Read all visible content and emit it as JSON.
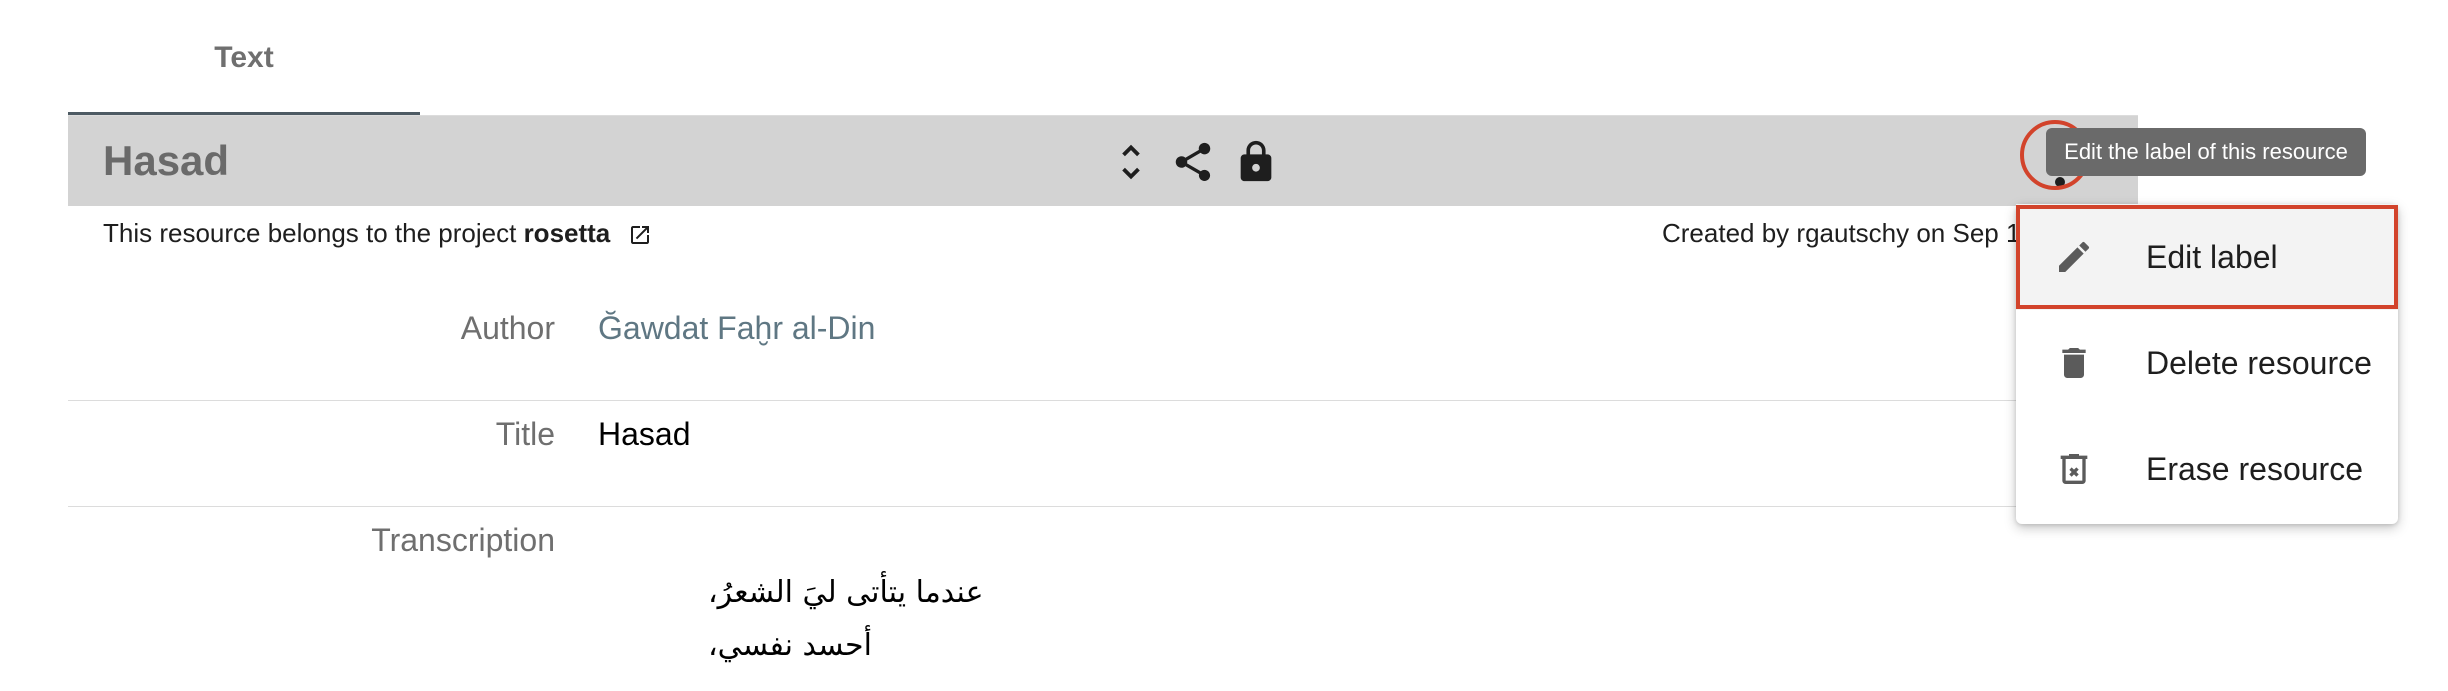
{
  "tabs": [
    {
      "label": "Text"
    }
  ],
  "header": {
    "title": "Hasad",
    "icons": [
      "expand-collapse-icon",
      "share-icon",
      "lock-icon",
      "more-vert-icon"
    ]
  },
  "info": {
    "project_prefix": "This resource belongs to the project ",
    "project_name": "rosetta",
    "created": "Created by rgautschy on Sep 1"
  },
  "properties": {
    "author": {
      "label": "Author",
      "value": "Ğawdat Faḫr al-Din"
    },
    "title": {
      "label": "Title",
      "value": "Hasad"
    },
    "transcription": {
      "label": "Transcription",
      "lines": [
        "عندما يتأتى ليَ الشعرُ،",
        "أحسد نفسي،"
      ]
    }
  },
  "tooltip": "Edit the label of this resource",
  "menu": {
    "items": [
      {
        "label": "Edit label",
        "icon": "pencil-icon"
      },
      {
        "label": "Delete resource",
        "icon": "trash-icon"
      },
      {
        "label": "Erase resource",
        "icon": "trash-x-icon"
      }
    ]
  },
  "colors": {
    "accent": "#d2432b",
    "link": "#5f7783",
    "header_bg": "#d3d3d3"
  }
}
